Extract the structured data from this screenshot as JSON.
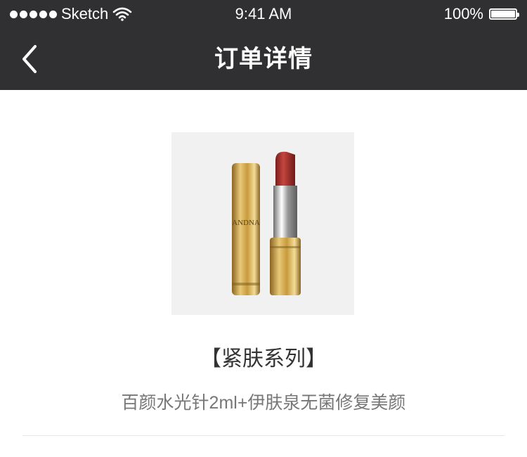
{
  "status_bar": {
    "carrier": "Sketch",
    "time": "9:41 AM",
    "battery": "100%"
  },
  "navbar": {
    "title": "订单详情"
  },
  "product": {
    "image": "lipstick-product-image",
    "brand_text": "ANDNA",
    "series": "【紧肤系列】",
    "description": "百颜水光针2ml+伊肤泉无菌修复美颜"
  },
  "colors": {
    "header_bg": "#303033",
    "image_bg": "#f0f1f0",
    "gold": "#c9a14a",
    "lipstick_red": "#a8322e"
  }
}
